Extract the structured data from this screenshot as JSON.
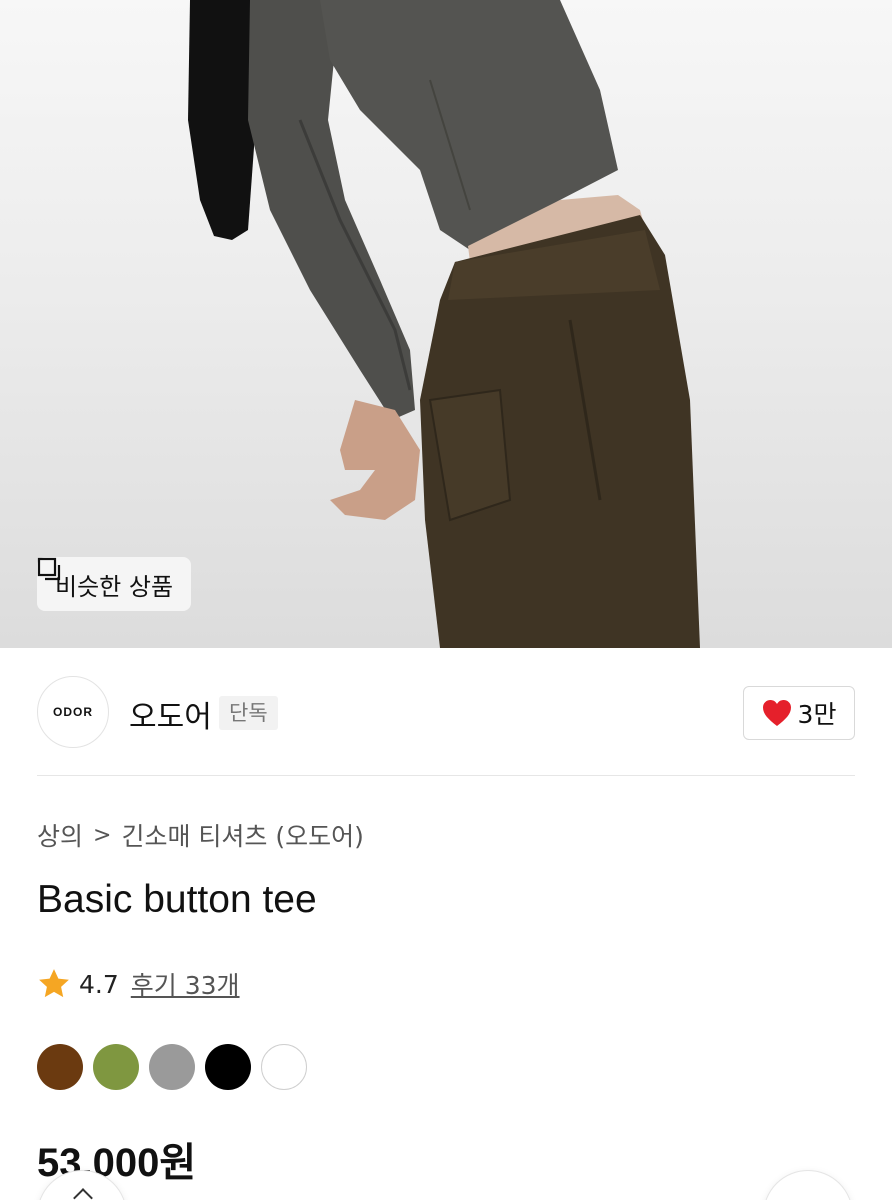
{
  "hero": {
    "similar_button_label": "비슷한 상품",
    "similar_icon": "layers-icon"
  },
  "brand": {
    "logo_text": "ODOR",
    "name": "오도어",
    "tag": "단독",
    "like_count": "3만",
    "like_icon": "heart-icon",
    "like_color": "#e5202b"
  },
  "breadcrumb": {
    "category": "상의",
    "separator": ">",
    "subcategory": "긴소매 티셔츠 (오도어)"
  },
  "product": {
    "title": "Basic button tee",
    "rating": "4.7",
    "reviews_label": "후기 33개",
    "star_color": "#f5a623",
    "price": "53,000원"
  },
  "colors": [
    {
      "name": "brown",
      "hex": "#6b3a10"
    },
    {
      "name": "olive",
      "hex": "#7f9740"
    },
    {
      "name": "gray",
      "hex": "#9a9a9a"
    },
    {
      "name": "black",
      "hex": "#000000"
    },
    {
      "name": "white",
      "hex": "#ffffff"
    }
  ]
}
